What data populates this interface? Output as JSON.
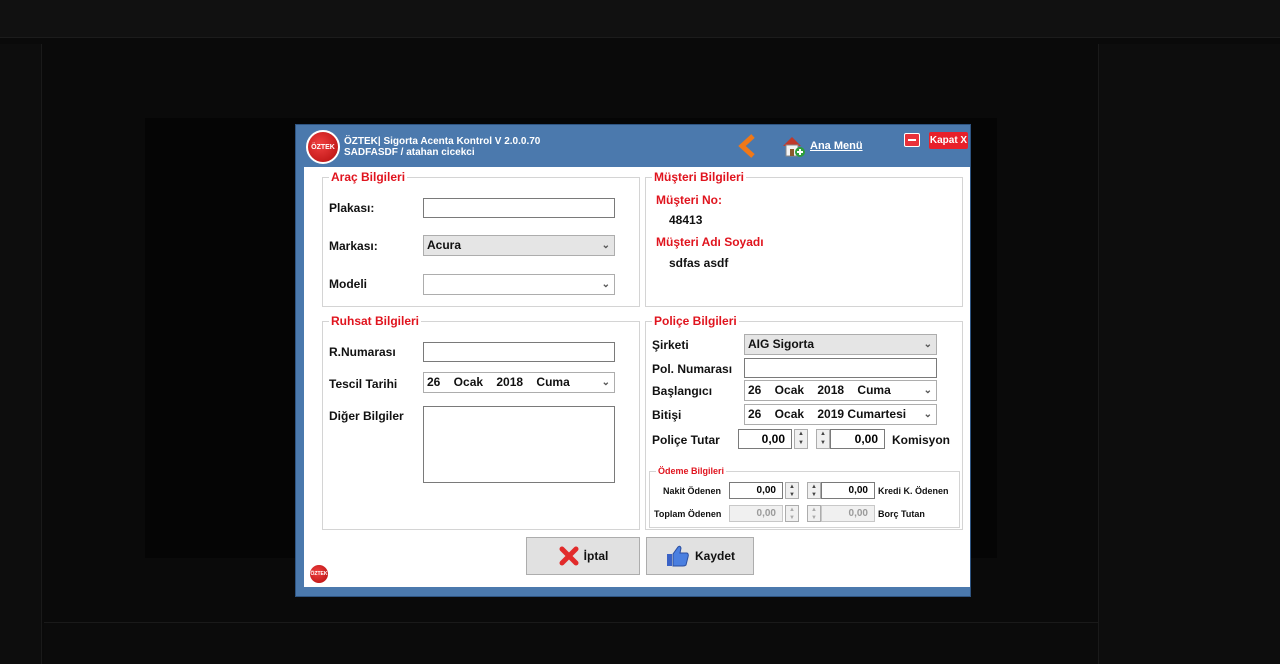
{
  "window": {
    "title_line1": "ÖZTEK| Sigorta Acenta Kontrol V 2.0.0.70",
    "title_line2": "SADFASDF / atahan cicekci",
    "logo_text": "ÖZTEK",
    "home_label": "Ana Menü",
    "close_label": "Kapat X"
  },
  "arac": {
    "title": "Araç Bilgileri",
    "plaka_label": "Plakası:",
    "plaka_value": "",
    "marka_label": "Markası:",
    "marka_value": "Acura",
    "model_label": "Modeli",
    "model_value": ""
  },
  "musteri": {
    "title": "Müşteri Bilgileri",
    "no_label": "Müşteri No:",
    "no_value": "48413",
    "ad_label": "Müşteri Adı Soyadı",
    "ad_value": "sdfas asdf"
  },
  "ruhsat": {
    "title": "Ruhsat Bilgileri",
    "numara_label": "R.Numarası",
    "numara_value": "",
    "tescil_label": "Tescil Tarihi",
    "tescil_value": "26    Ocak    2018    Cuma",
    "diger_label": "Diğer Bilgiler"
  },
  "police": {
    "title": "Poliçe Bilgileri",
    "sirket_label": "Şirketi",
    "sirket_value": "AIG Sigorta",
    "numara_label": "Pol. Numarası",
    "baslangic_label": "Başlangıcı",
    "baslangic_value": "26    Ocak    2018    Cuma",
    "bitis_label": "Bitişi",
    "bitis_value": "26    Ocak    2019 Cumartesi",
    "tutar_label": "Poliçe Tutar",
    "tutar_value": "0,00",
    "komisyon_value": "0,00",
    "komisyon_label": "Komisyon"
  },
  "odeme": {
    "title": "Ödeme Bilgileri",
    "nakit_label": "Nakit Ödenen",
    "nakit_value": "0,00",
    "kredi_value": "0,00",
    "kredi_label": "Kredi K. Ödenen",
    "toplam_label": "Toplam Ödenen",
    "toplam_value": "0,00",
    "borc_value": "0,00",
    "borc_label": "Borç Tutan"
  },
  "buttons": {
    "iptal": "İptal",
    "kaydet": "Kaydet"
  },
  "colors": {
    "accent_red": "#e0141e",
    "window_blue": "#4b79ad"
  }
}
